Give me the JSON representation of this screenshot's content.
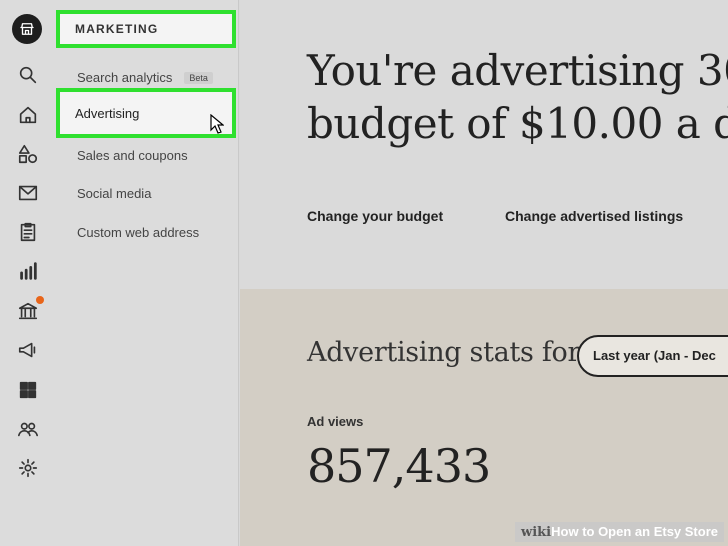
{
  "submenu": {
    "heading": "MARKETING",
    "items": [
      {
        "label": "Search analytics",
        "badge": "Beta"
      },
      {
        "label": "Advertising"
      },
      {
        "label": "Sales and coupons"
      },
      {
        "label": "Social media"
      },
      {
        "label": "Custom web address"
      }
    ]
  },
  "main": {
    "headline_line1": "You're advertising 30",
    "headline_line2": "budget of $10.00 a da",
    "links": [
      "Change your budget",
      "Change advertised listings"
    ],
    "stats_title": "Advertising stats for",
    "range_select": "Last year (Jan - Dec",
    "ad_views_label": "Ad views",
    "ad_views_value": "857,433"
  },
  "rail_icons": [
    "shop-icon",
    "search-icon",
    "home-icon",
    "shapes-icon",
    "mail-icon",
    "clipboard-icon",
    "stats-icon",
    "bank-icon",
    "megaphone-icon",
    "grid-icon",
    "people-icon",
    "gear-icon"
  ],
  "watermark": {
    "wiki": "wiki",
    "how": "How",
    "rest": "to Open an Etsy Store"
  },
  "colors": {
    "highlight": "#2fe02f",
    "notification": "#e8651a"
  }
}
